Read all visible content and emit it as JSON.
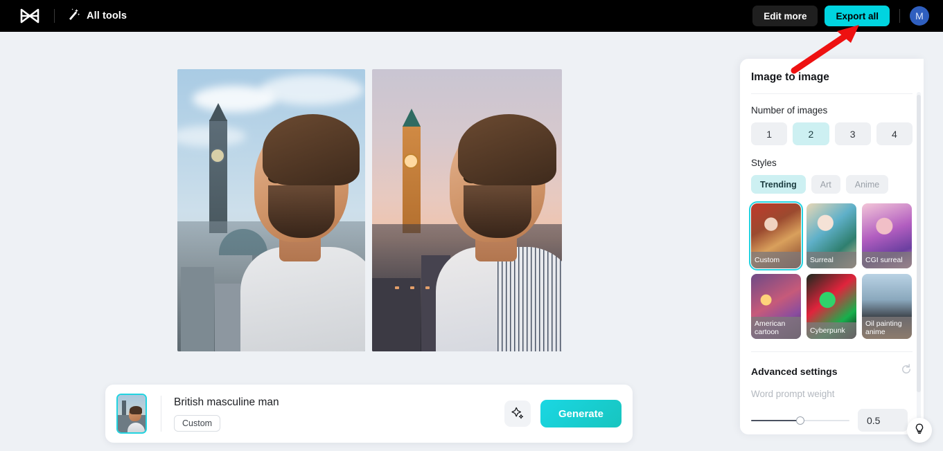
{
  "topbar": {
    "logo_icon": "capcut-logo-icon",
    "magic_icon": "magic-wand-icon",
    "all_tools_label": "All tools",
    "edit_more_label": "Edit more",
    "export_all_label": "Export all",
    "avatar_initial": "M",
    "accent_color": "#00d4e0",
    "avatar_color": "#2f5fbf",
    "background": "#000000"
  },
  "canvas": {
    "results": [
      {
        "name": "generated-image-1",
        "alt": "British masculine man, daytime London skyline with clock tower"
      },
      {
        "name": "generated-image-2",
        "alt": "British masculine man, dusk London skyline with Big Ben, striped shirt"
      }
    ]
  },
  "prompt_bar": {
    "thumbnail_name": "source-image-thumbnail",
    "prompt_text": "British masculine man",
    "tag_label": "Custom",
    "sparkle_icon": "sparkle-icon",
    "generate_label": "Generate",
    "generate_color": "#1ad7e3"
  },
  "panel": {
    "title": "Image to image",
    "number_of_images": {
      "label": "Number of images",
      "options": [
        "1",
        "2",
        "3",
        "4"
      ],
      "selected": "2",
      "selected_color": "#cdf0f2"
    },
    "styles": {
      "label": "Styles",
      "tabs": [
        "Trending",
        "Art",
        "Anime"
      ],
      "tab_selected": "Trending",
      "cards": [
        {
          "label": "Custom",
          "selected": true
        },
        {
          "label": "Surreal",
          "selected": false
        },
        {
          "label": "CGI surreal",
          "selected": false
        },
        {
          "label": "American cartoon",
          "selected": false
        },
        {
          "label": "Cyberpunk",
          "selected": false
        },
        {
          "label": "Oil painting anime",
          "selected": false
        }
      ],
      "selection_color": "#22d3e0"
    },
    "advanced": {
      "title": "Advanced settings",
      "reset_icon": "reset-icon",
      "slider_label": "Word prompt weight",
      "slider_value": "0.5",
      "slider_percent": 50
    },
    "scrollbar_name": "panel-scrollbar"
  },
  "help": {
    "icon": "lightbulb-icon"
  },
  "annotation": {
    "arrow_color": "#ee1111",
    "points_to": "export-all-button"
  }
}
